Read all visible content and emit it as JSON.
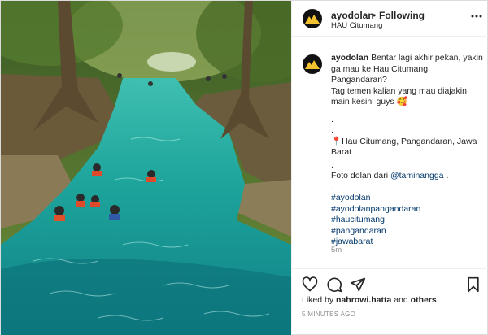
{
  "header": {
    "username": "ayodolan",
    "dot": "•",
    "follow_status": "Following",
    "location": "HAU Citumang",
    "more_icon": "more-horizontal-icon"
  },
  "caption": {
    "author": "ayodolan",
    "line1": "Bentar lagi akhir pekan, yakin ga mau ke Hau Citumang Pangandaran?",
    "line2": "Tag temen kalian yang mau diajakin main kesini guys 🥰",
    "dot1": ".",
    "dot2": ".",
    "location_line": "📍Hau Citumang, Pangandaran, Jawa Barat",
    "dot3": ".",
    "credit_prefix": "Foto dolan dari",
    "credit_handle": "@taminangga",
    "credit_suffix": ".",
    "dot4": ".",
    "hashtags": [
      "#ayodolan",
      "#ayodolanpangandaran",
      "#haucitumang",
      "#pangandaran",
      "#jawabarat"
    ],
    "age": "5m"
  },
  "likes": {
    "prefix": "Liked by",
    "user": "nahrowi.hatta",
    "and": "and",
    "others": "others"
  },
  "timestamp": "5 MINUTES AGO",
  "icons": {
    "like": "heart-icon",
    "comment": "comment-icon",
    "share": "share-icon",
    "save": "bookmark-icon"
  },
  "colors": {
    "link": "#00376b",
    "secondary": "#8e8e8e",
    "water": "#1fa5a0"
  }
}
